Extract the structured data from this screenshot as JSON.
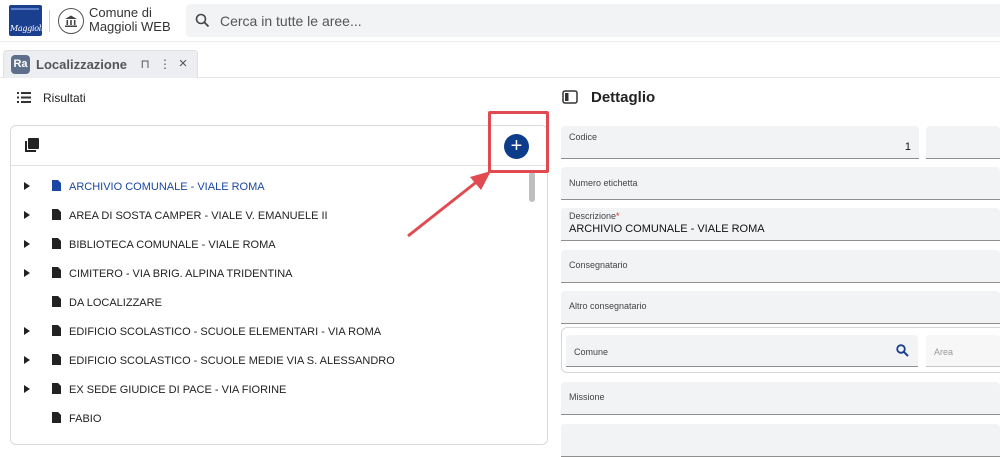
{
  "header": {
    "logo_text": "Maggioli",
    "app_name_line1": "Comune di",
    "app_name_line2": "Maggioli WEB",
    "search_placeholder": "Cerca in tutte le aree..."
  },
  "tab": {
    "badge": "Ra",
    "label": "Localizzazione",
    "pin_glyph": "⊓",
    "menu_glyph": "⋮",
    "close_glyph": "×"
  },
  "left": {
    "title": "Risultati",
    "add_glyph": "+",
    "tree": [
      {
        "label": "ARCHIVIO COMUNALE - VIALE ROMA",
        "expandable": true,
        "selected": true
      },
      {
        "label": "AREA DI SOSTA CAMPER - VIALE V. EMANUELE II",
        "expandable": true,
        "selected": false
      },
      {
        "label": "BIBLIOTECA COMUNALE - VIALE ROMA",
        "expandable": true,
        "selected": false
      },
      {
        "label": "CIMITERO - VIA BRIG. ALPINA TRIDENTINA",
        "expandable": true,
        "selected": false
      },
      {
        "label": "DA LOCALIZZARE",
        "expandable": false,
        "selected": false
      },
      {
        "label": "EDIFICIO SCOLASTICO -  SCUOLE ELEMENTARI -  VIA ROMA",
        "expandable": true,
        "selected": false
      },
      {
        "label": "EDIFICIO SCOLASTICO - SCUOLE MEDIE VIA S. ALESSANDRO",
        "expandable": true,
        "selected": false
      },
      {
        "label": "EX SEDE GIUDICE DI PACE - VIA FIORINE",
        "expandable": true,
        "selected": false
      },
      {
        "label": "FABIO",
        "expandable": false,
        "selected": false
      }
    ]
  },
  "right": {
    "title": "Dettaglio",
    "fields": {
      "codice": {
        "label": "Codice",
        "value": "1"
      },
      "numero_etichetta": {
        "label": "Numero etichetta",
        "value": ""
      },
      "descrizione": {
        "label": "Descrizione",
        "required_mark": "*",
        "value": "ARCHIVIO COMUNALE - VIALE ROMA"
      },
      "consegnatario": {
        "label": "Consegnatario",
        "value": ""
      },
      "altro_consegnatario": {
        "label": "Altro consegnatario",
        "value": ""
      },
      "comune": {
        "label": "Comune",
        "value": ""
      },
      "area": {
        "label": "Area",
        "value": ""
      },
      "missione": {
        "label": "Missione",
        "value": ""
      }
    }
  },
  "colors": {
    "accent": "#0d3c8a",
    "selected_text": "#1b47a4",
    "highlight": "#e04a50",
    "field_bg": "#f2f3f5"
  }
}
